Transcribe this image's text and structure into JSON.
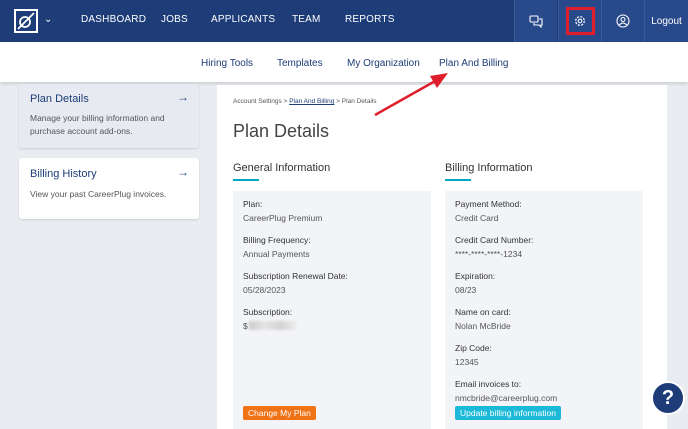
{
  "nav": {
    "items": [
      "DASHBOARD",
      "JOBS",
      "APPLICANTS",
      "TEAM",
      "REPORTS"
    ],
    "logout": "Logout"
  },
  "subnav": [
    "Hiring Tools",
    "Templates",
    "My Organization",
    "Plan And Billing"
  ],
  "sidebar": {
    "plan": {
      "title": "Plan Details",
      "desc": "Manage your billing information and purchase account add-ons."
    },
    "history": {
      "title": "Billing History",
      "desc": "View your past CareerPlug invoices."
    }
  },
  "breadcrumb": {
    "root": "Account Settings",
    "sep1": ">",
    "mid": "Plan And Billing",
    "sep2": ">",
    "current": "Plan Details"
  },
  "page_title": "Plan Details",
  "general": {
    "title": "General Information",
    "plan_label": "Plan:",
    "plan_value": "CareerPlug Premium",
    "freq_label": "Billing Frequency:",
    "freq_value": "Annual Payments",
    "renew_label": "Subscription Renewal Date:",
    "renew_value": "05/28/2023",
    "sub_label": "Subscription:",
    "sub_value": "$",
    "change_btn": "Change My Plan"
  },
  "billing": {
    "title": "Billing Information",
    "method_label": "Payment Method:",
    "method_value": "Credit Card",
    "card_label": "Credit Card Number:",
    "card_value": "****-****-****-1234",
    "exp_label": "Expiration:",
    "exp_value": "08/23",
    "name_label": "Name on card:",
    "name_value": "Nolan McBride",
    "zip_label": "Zip Code:",
    "zip_value": "12345",
    "email_label": "Email invoices to:",
    "email_value": "nmcbride@careerplug.com",
    "update_btn": "Update billing information"
  },
  "help": "?",
  "colors": {
    "nav": "#1d3c78",
    "accent": "#00a9c7",
    "highlight": "#e01e2b",
    "orange": "#f07217"
  }
}
